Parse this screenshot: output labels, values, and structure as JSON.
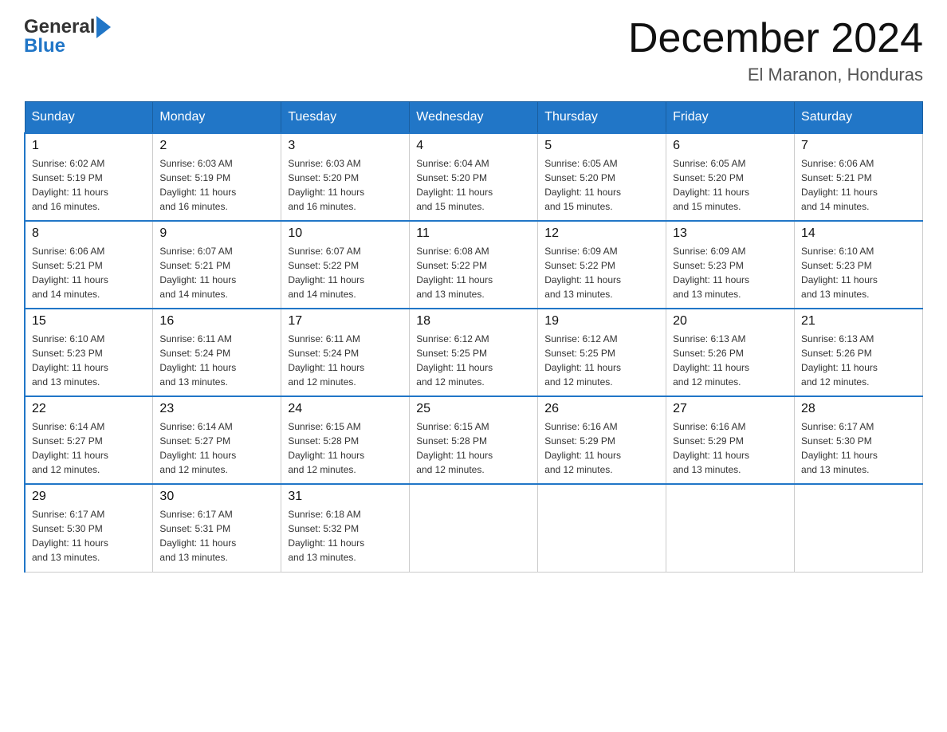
{
  "header": {
    "logo_general": "General",
    "logo_blue": "Blue",
    "title": "December 2024",
    "location": "El Maranon, Honduras"
  },
  "days_of_week": [
    "Sunday",
    "Monday",
    "Tuesday",
    "Wednesday",
    "Thursday",
    "Friday",
    "Saturday"
  ],
  "weeks": [
    [
      {
        "day": "1",
        "sunrise": "6:02 AM",
        "sunset": "5:19 PM",
        "daylight": "11 hours and 16 minutes."
      },
      {
        "day": "2",
        "sunrise": "6:03 AM",
        "sunset": "5:19 PM",
        "daylight": "11 hours and 16 minutes."
      },
      {
        "day": "3",
        "sunrise": "6:03 AM",
        "sunset": "5:20 PM",
        "daylight": "11 hours and 16 minutes."
      },
      {
        "day": "4",
        "sunrise": "6:04 AM",
        "sunset": "5:20 PM",
        "daylight": "11 hours and 15 minutes."
      },
      {
        "day": "5",
        "sunrise": "6:05 AM",
        "sunset": "5:20 PM",
        "daylight": "11 hours and 15 minutes."
      },
      {
        "day": "6",
        "sunrise": "6:05 AM",
        "sunset": "5:20 PM",
        "daylight": "11 hours and 15 minutes."
      },
      {
        "day": "7",
        "sunrise": "6:06 AM",
        "sunset": "5:21 PM",
        "daylight": "11 hours and 14 minutes."
      }
    ],
    [
      {
        "day": "8",
        "sunrise": "6:06 AM",
        "sunset": "5:21 PM",
        "daylight": "11 hours and 14 minutes."
      },
      {
        "day": "9",
        "sunrise": "6:07 AM",
        "sunset": "5:21 PM",
        "daylight": "11 hours and 14 minutes."
      },
      {
        "day": "10",
        "sunrise": "6:07 AM",
        "sunset": "5:22 PM",
        "daylight": "11 hours and 14 minutes."
      },
      {
        "day": "11",
        "sunrise": "6:08 AM",
        "sunset": "5:22 PM",
        "daylight": "11 hours and 13 minutes."
      },
      {
        "day": "12",
        "sunrise": "6:09 AM",
        "sunset": "5:22 PM",
        "daylight": "11 hours and 13 minutes."
      },
      {
        "day": "13",
        "sunrise": "6:09 AM",
        "sunset": "5:23 PM",
        "daylight": "11 hours and 13 minutes."
      },
      {
        "day": "14",
        "sunrise": "6:10 AM",
        "sunset": "5:23 PM",
        "daylight": "11 hours and 13 minutes."
      }
    ],
    [
      {
        "day": "15",
        "sunrise": "6:10 AM",
        "sunset": "5:23 PM",
        "daylight": "11 hours and 13 minutes."
      },
      {
        "day": "16",
        "sunrise": "6:11 AM",
        "sunset": "5:24 PM",
        "daylight": "11 hours and 13 minutes."
      },
      {
        "day": "17",
        "sunrise": "6:11 AM",
        "sunset": "5:24 PM",
        "daylight": "11 hours and 12 minutes."
      },
      {
        "day": "18",
        "sunrise": "6:12 AM",
        "sunset": "5:25 PM",
        "daylight": "11 hours and 12 minutes."
      },
      {
        "day": "19",
        "sunrise": "6:12 AM",
        "sunset": "5:25 PM",
        "daylight": "11 hours and 12 minutes."
      },
      {
        "day": "20",
        "sunrise": "6:13 AM",
        "sunset": "5:26 PM",
        "daylight": "11 hours and 12 minutes."
      },
      {
        "day": "21",
        "sunrise": "6:13 AM",
        "sunset": "5:26 PM",
        "daylight": "11 hours and 12 minutes."
      }
    ],
    [
      {
        "day": "22",
        "sunrise": "6:14 AM",
        "sunset": "5:27 PM",
        "daylight": "11 hours and 12 minutes."
      },
      {
        "day": "23",
        "sunrise": "6:14 AM",
        "sunset": "5:27 PM",
        "daylight": "11 hours and 12 minutes."
      },
      {
        "day": "24",
        "sunrise": "6:15 AM",
        "sunset": "5:28 PM",
        "daylight": "11 hours and 12 minutes."
      },
      {
        "day": "25",
        "sunrise": "6:15 AM",
        "sunset": "5:28 PM",
        "daylight": "11 hours and 12 minutes."
      },
      {
        "day": "26",
        "sunrise": "6:16 AM",
        "sunset": "5:29 PM",
        "daylight": "11 hours and 12 minutes."
      },
      {
        "day": "27",
        "sunrise": "6:16 AM",
        "sunset": "5:29 PM",
        "daylight": "11 hours and 13 minutes."
      },
      {
        "day": "28",
        "sunrise": "6:17 AM",
        "sunset": "5:30 PM",
        "daylight": "11 hours and 13 minutes."
      }
    ],
    [
      {
        "day": "29",
        "sunrise": "6:17 AM",
        "sunset": "5:30 PM",
        "daylight": "11 hours and 13 minutes."
      },
      {
        "day": "30",
        "sunrise": "6:17 AM",
        "sunset": "5:31 PM",
        "daylight": "11 hours and 13 minutes."
      },
      {
        "day": "31",
        "sunrise": "6:18 AM",
        "sunset": "5:32 PM",
        "daylight": "11 hours and 13 minutes."
      },
      null,
      null,
      null,
      null
    ]
  ],
  "labels": {
    "sunrise": "Sunrise:",
    "sunset": "Sunset:",
    "daylight": "Daylight:"
  }
}
